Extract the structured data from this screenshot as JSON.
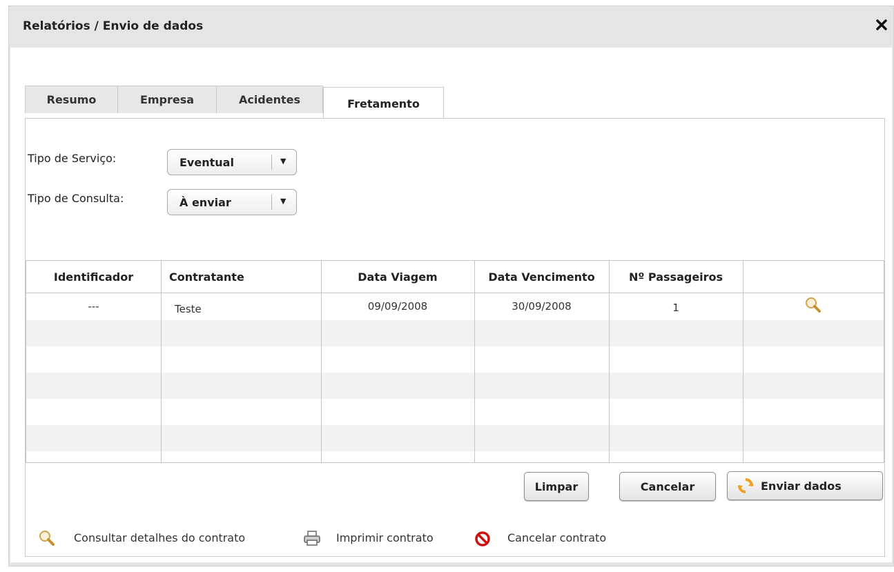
{
  "window": {
    "title": "Relatórios / Envio de dados",
    "close_label": "✕"
  },
  "tabs": [
    {
      "label": "Resumo",
      "active": false
    },
    {
      "label": "Empresa",
      "active": false
    },
    {
      "label": "Acidentes",
      "active": false
    },
    {
      "label": "Fretamento",
      "active": true
    }
  ],
  "form": {
    "service_type": {
      "label": "Tipo de Serviço:",
      "value": "Eventual"
    },
    "query_type": {
      "label": "Tipo de Consulta:",
      "value": "À enviar"
    }
  },
  "table": {
    "columns": [
      "Identificador",
      "Contratante",
      "Data Viagem",
      "Data Vencimento",
      "Nº Passageiros",
      ""
    ],
    "rows": [
      {
        "identificador": "---",
        "contratante": "Teste",
        "data_viagem": "09/09/2008",
        "data_vencimento": "30/09/2008",
        "passageiros": "1",
        "action_icon": "search-icon"
      }
    ]
  },
  "buttons": {
    "clear": "Limpar",
    "cancel": "Cancelar",
    "send": "Enviar dados"
  },
  "legend": {
    "view_details": "Consultar detalhes do contrato",
    "print": "Imprimir contrato",
    "cancel_contract": "Cancelar contrato"
  },
  "colors": {
    "window_bg": "#e5e5e5",
    "stripe": "#f2f2f2",
    "cancel_red": "#cc1111",
    "refresh_orange": "#f0a020"
  }
}
